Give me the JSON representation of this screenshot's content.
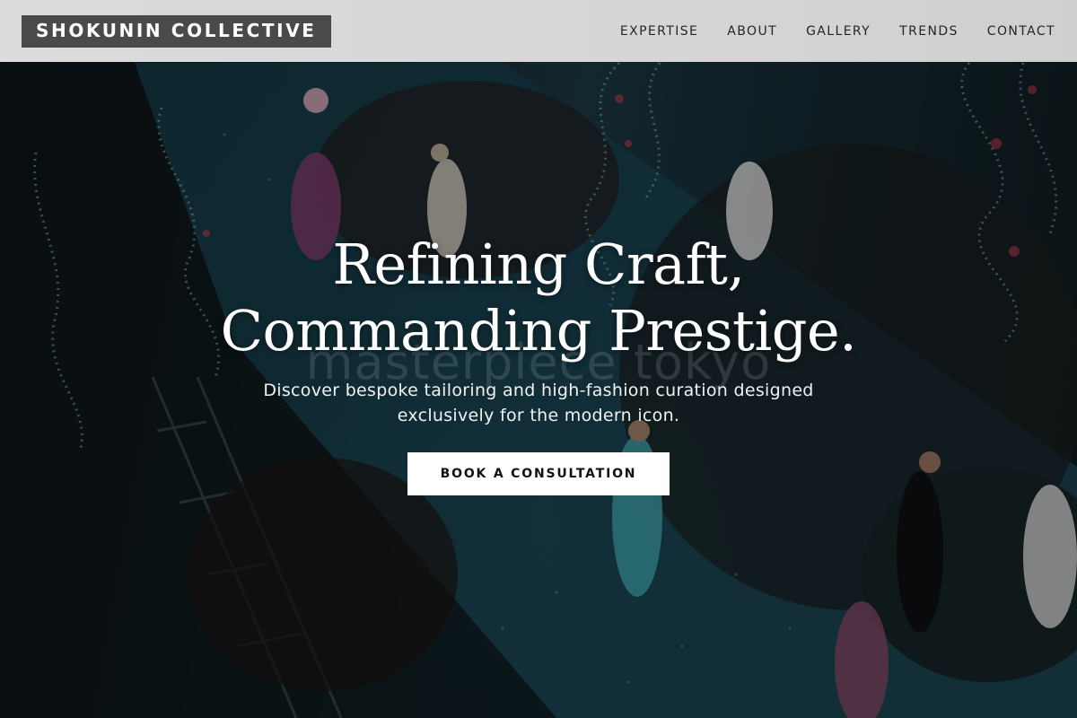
{
  "brand": {
    "logo_text": "SHOKUNIN COLLECTIVE"
  },
  "nav": {
    "items": [
      {
        "label": "EXPERTISE"
      },
      {
        "label": "ABOUT"
      },
      {
        "label": "GALLERY"
      },
      {
        "label": "TRENDS"
      },
      {
        "label": "CONTACT"
      }
    ]
  },
  "hero": {
    "title_line1": "Refining Craft,",
    "title_line2": "Commanding Prestige.",
    "background_watermark": "masterpiece tokyo",
    "subtitle": "Discover bespoke tailoring and high-fashion curation designed exclusively for the modern icon.",
    "cta_label": "BOOK A CONSULTATION"
  },
  "colors": {
    "header_bg": "#d6d6d6",
    "logo_bg": "#4a4a4a",
    "cta_bg": "#ffffff",
    "runway_teal": "#1d4a58"
  }
}
